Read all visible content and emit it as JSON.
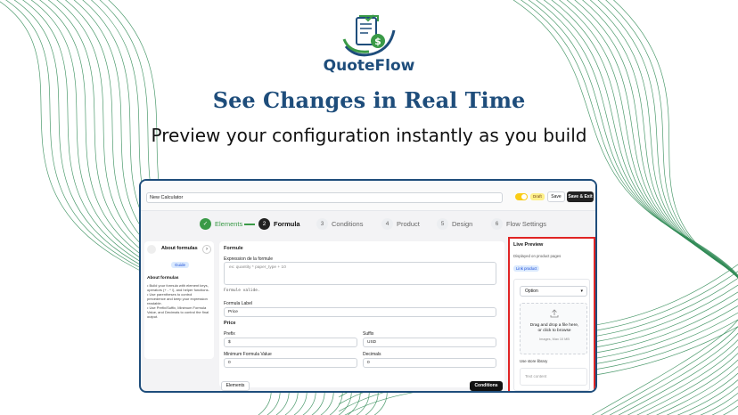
{
  "brand": {
    "name": "QuoteFlow",
    "colors": {
      "primary": "#1e4d7b",
      "accent": "#3a9a47",
      "highlight": "#e02424"
    },
    "headline": "See Changes in Real Time",
    "subheadline": "Preview your configuration instantly as you build"
  },
  "app": {
    "calculator_name": "New Calculator",
    "status_badge": "Draft",
    "save_label": "Save",
    "save_exit_label": "Save & Exit",
    "steps": [
      {
        "number": "✓",
        "label": "Elements",
        "state": "done"
      },
      {
        "number": "2",
        "label": "Formula",
        "state": "active"
      },
      {
        "number": "3",
        "label": "Conditions",
        "state": "todo"
      },
      {
        "number": "4",
        "label": "Product",
        "state": "todo"
      },
      {
        "number": "5",
        "label": "Design",
        "state": "todo"
      },
      {
        "number": "6",
        "label": "Flow Settings",
        "state": "todo"
      }
    ]
  },
  "help": {
    "title": "About formulas",
    "badge": "Guide",
    "subtitle": "About formulas",
    "body": "• Build your formula with element keys, operators (+ - * /), and helper functions.\n• Use parentheses to control precedence and keep your expression readable.\n• Use Prefix/Suffix, Minimum Formula Value, and Decimals to control the final output."
  },
  "formula": {
    "section_title": "Formule",
    "expression_label": "Expression de la formule",
    "expression_placeholder": "ex: quantity * paper_type + 10",
    "validation_text": "Formule valide.",
    "formula_label_label": "Formula Label",
    "formula_label_value": "Price",
    "price_section": "Price",
    "prefix_label": "Prefix",
    "prefix_value": "$",
    "suffix_label": "Suffix",
    "suffix_value": "USD",
    "min_value_label": "Minimum Formula Value",
    "min_value_value": "0",
    "decimals_label": "Decimals",
    "decimals_value": "0",
    "back_button": "Elements",
    "next_button": "Conditions"
  },
  "preview": {
    "title": "Live Preview",
    "subtitle": "Displayed on product pages",
    "link_badge": "Link product",
    "select_value": "Option",
    "drop_text": "Drag and drop a file here,\nor click to browse",
    "drop_hint": "Images, Max 10 MB",
    "store_library": "Use store library",
    "text_placeholder": "Text content"
  }
}
